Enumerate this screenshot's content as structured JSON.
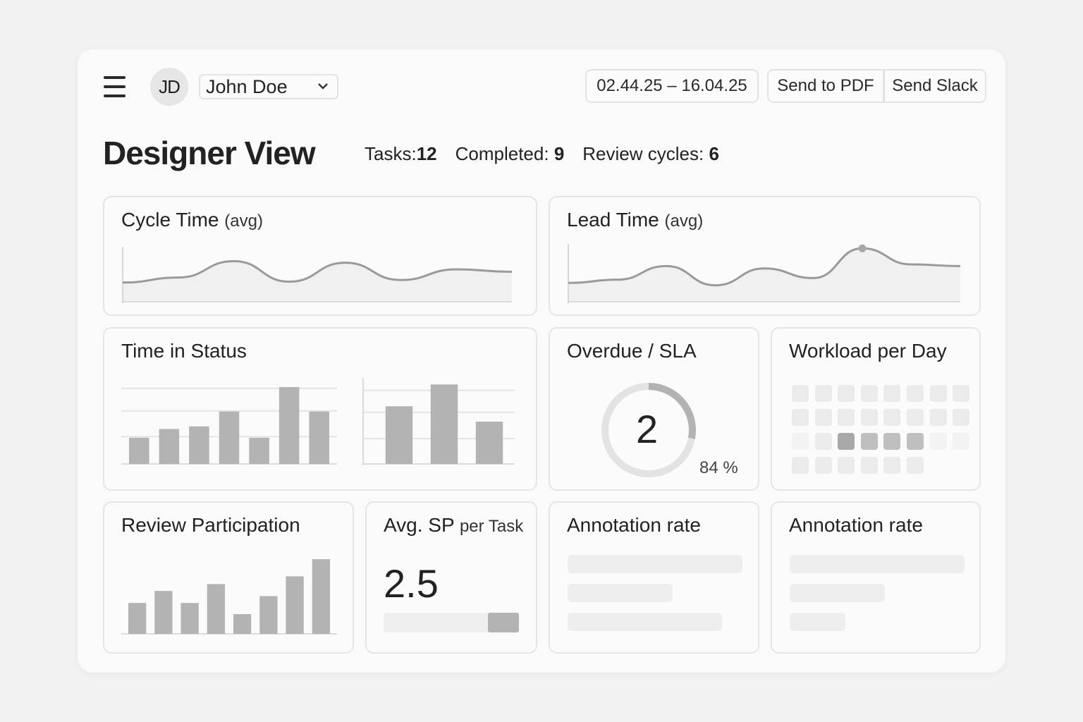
{
  "header": {
    "avatar_initials": "JD",
    "user_name": "John Doe",
    "date_range": "02.44.25 – 16.04.25",
    "send_pdf_label": "Send to PDF",
    "send_slack_label": "Send Slack"
  },
  "page": {
    "title": "Designer View",
    "stats": [
      {
        "label": "Tasks:",
        "value": "12"
      },
      {
        "label": "Completed:",
        "value": "9"
      },
      {
        "label": "Review cycles:",
        "value": "6"
      }
    ]
  },
  "cards": {
    "cycle_time": {
      "title": "Cycle Time",
      "sub": "(avg)"
    },
    "lead_time": {
      "title": "Lead Time",
      "sub": "(avg)"
    },
    "time_in_status": {
      "title": "Time in Status"
    },
    "overdue": {
      "title": "Overdue / SLA",
      "value": "2",
      "percent_label": "84 %",
      "percent": 0.84
    },
    "workload": {
      "title": "Workload per Day"
    },
    "review": {
      "title": "Review Participation"
    },
    "avg_sp": {
      "title": "Avg. SP",
      "sub": "per Task",
      "value": "2.5"
    },
    "annotation_1": {
      "title": "Annotation rate"
    },
    "annotation_2": {
      "title": "Annotation rate"
    }
  },
  "chart_data": [
    {
      "type": "line",
      "title": "Cycle Time (avg)",
      "series": [
        {
          "values": [
            2,
            2.6,
            4.6,
            2.1,
            4.4,
            2.3,
            3.6,
            3.3
          ]
        }
      ]
    },
    {
      "type": "line",
      "title": "Lead Time (avg)",
      "series": [
        {
          "values": [
            2,
            2.4,
            4.1,
            1.7,
            3.8,
            2.6,
            6.3,
            4.3,
            4.1
          ]
        }
      ]
    },
    {
      "type": "bar",
      "title": "Time in Status",
      "values": [
        3,
        4,
        4.3,
        6,
        3,
        8.8,
        6
      ]
    },
    {
      "type": "bar",
      "title": "Time in Status",
      "values": [
        4.5,
        6.2,
        3.3
      ]
    },
    {
      "type": "bar",
      "title": "Review Participation",
      "values": [
        3.6,
        5,
        3.6,
        5.8,
        2.3,
        4.4,
        6.7,
        8.7
      ]
    },
    {
      "type": "heatmap",
      "title": "Workload per Day",
      "rows": [
        [
          1,
          1,
          1,
          1,
          1,
          1,
          1,
          1
        ],
        [
          1,
          1,
          1,
          1,
          1,
          1,
          1,
          1
        ],
        [
          0,
          1,
          4,
          3,
          3,
          3,
          0,
          0
        ],
        [
          1,
          1,
          1,
          1,
          1,
          1
        ]
      ]
    }
  ],
  "colors": {
    "bar": "#b3b3b3",
    "line": "#9a9a9a",
    "ring_track": "#e3e3e3",
    "ring_fill": "#b3b3b3"
  }
}
